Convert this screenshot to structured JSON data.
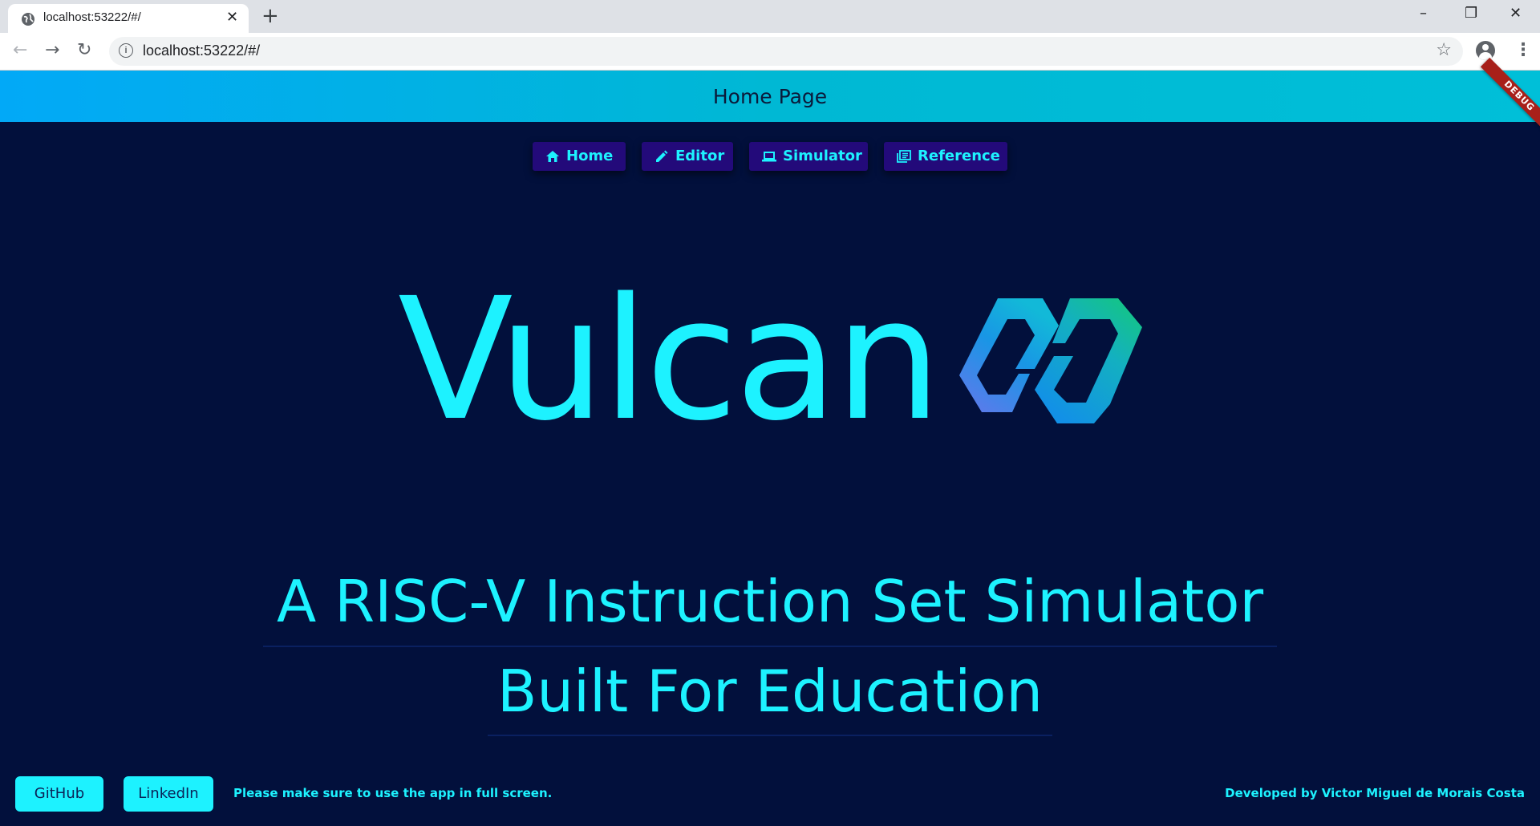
{
  "browser": {
    "tab_title": "localhost:53222/#/",
    "tab_close": "✕",
    "new_tab": "+",
    "url": "localhost:53222/#/",
    "window_controls": {
      "minimize": "–",
      "restore": "❐",
      "close": "✕"
    },
    "nav": {
      "back": "←",
      "forward": "→",
      "reload": "↻"
    },
    "star": "☆",
    "menu": "⋮"
  },
  "app": {
    "title": "Home Page",
    "debug_banner": "DEBUG",
    "nav_items": [
      {
        "label": "Home",
        "icon": "home-icon"
      },
      {
        "label": "Editor",
        "icon": "pencil-icon"
      },
      {
        "label": "Simulator",
        "icon": "laptop-icon"
      },
      {
        "label": "Reference",
        "icon": "library-books-icon"
      }
    ],
    "logo_text": "Vulcan",
    "tagline_1": "A RISC-V Instruction Set Simulator",
    "tagline_2": "Built For Education",
    "footer": {
      "github": "GitHub",
      "linkedin": "LinkedIn",
      "note": "Please make sure to use the app in full screen.",
      "credit": "Developed by Victor Miguel de Morais Costa"
    },
    "colors": {
      "background": "#02103c",
      "accent": "#1df2ff",
      "nav_button": "#230a7a",
      "appbar": "#02a9f7"
    }
  }
}
